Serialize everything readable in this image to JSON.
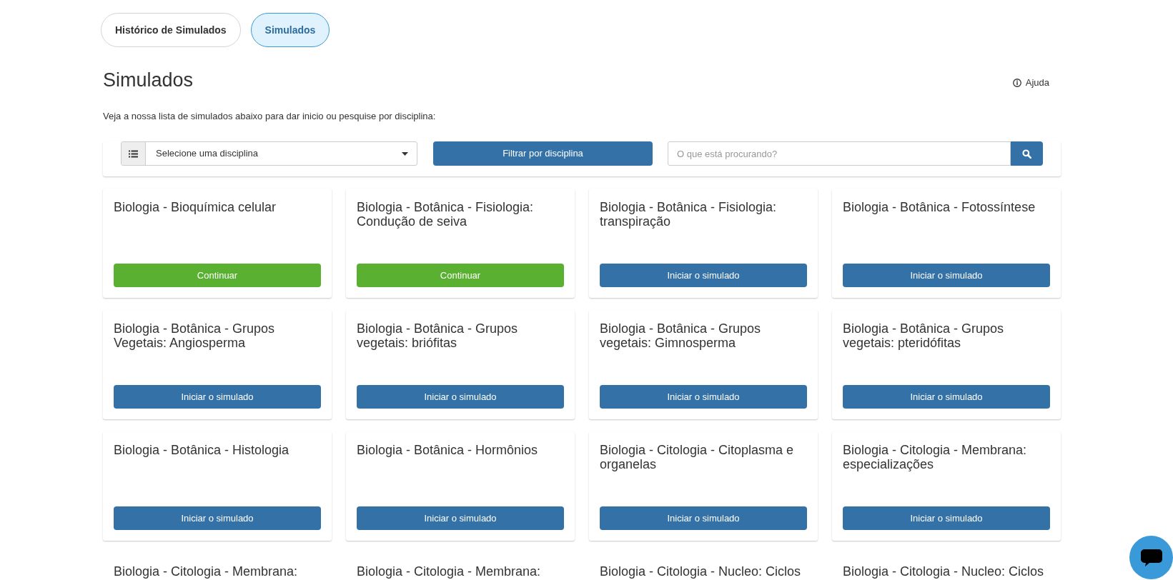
{
  "tabs": [
    {
      "label": "Histórico de Simulados",
      "selected": false
    },
    {
      "label": "Simulados",
      "selected": true
    }
  ],
  "header": {
    "title": "Simulados",
    "help_link": "Ajuda"
  },
  "intro": "Veja a nossa lista de simulados abaixo para dar inicio ou pesquise por disciplina:",
  "filter": {
    "select": {
      "value": "Selecione uma disciplina"
    },
    "filter_button": "Filtrar por disciplina",
    "search": {
      "placeholder": "O que está procurando?"
    }
  },
  "cards": [
    {
      "title": "Biologia - Bioquímica celular",
      "button": {
        "kind": "continue",
        "label": "Continuar"
      }
    },
    {
      "title": "Biologia - Botânica - Fisiologia: Condução de seiva",
      "button": {
        "kind": "continue",
        "label": "Continuar"
      }
    },
    {
      "title": "Biologia - Botânica - Fisiologia: transpiração",
      "button": {
        "kind": "start",
        "label": "Iniciar o simulado"
      }
    },
    {
      "title": "Biologia - Botânica - Fotossíntese",
      "button": {
        "kind": "start",
        "label": "Iniciar o simulado"
      }
    },
    {
      "title": "Biologia - Botânica - Grupos Vegetais: Angiosperma",
      "button": {
        "kind": "start",
        "label": "Iniciar o simulado"
      }
    },
    {
      "title": "Biologia - Botânica - Grupos vegetais: briófitas",
      "button": {
        "kind": "start",
        "label": "Iniciar o simulado"
      }
    },
    {
      "title": "Biologia - Botânica - Grupos vegetais: Gimnosperma",
      "button": {
        "kind": "start",
        "label": "Iniciar o simulado"
      }
    },
    {
      "title": "Biologia - Botânica - Grupos vegetais: pteridófitas",
      "button": {
        "kind": "start",
        "label": "Iniciar o simulado"
      }
    },
    {
      "title": "Biologia - Botânica - Histologia",
      "button": {
        "kind": "start",
        "label": "Iniciar o simulado"
      }
    },
    {
      "title": "Biologia - Botânica - Hormônios",
      "button": {
        "kind": "start",
        "label": "Iniciar o simulado"
      }
    },
    {
      "title": "Biologia - Citologia - Citoplasma e organelas",
      "button": {
        "kind": "start",
        "label": "Iniciar o simulado"
      }
    },
    {
      "title": "Biologia - Citologia - Membrana: especializações",
      "button": {
        "kind": "start",
        "label": "Iniciar o simulado"
      }
    },
    {
      "title": "Biologia - Citologia - Membrana:"
    },
    {
      "title": "Biologia - Citologia - Membrana:"
    },
    {
      "title": "Biologia - Citologia - Nucleo: Ciclos"
    },
    {
      "title": "Biologia - Citologia - Nucleo: Ciclos"
    }
  ]
}
